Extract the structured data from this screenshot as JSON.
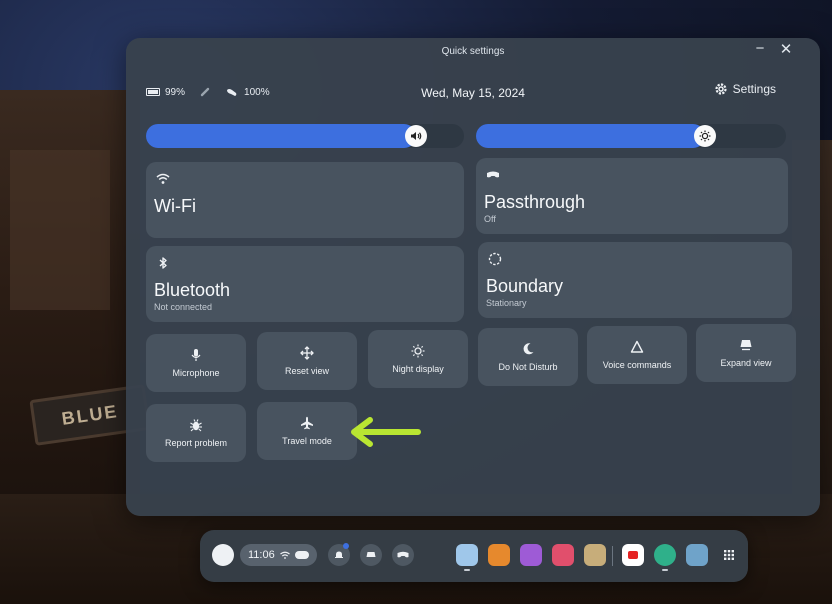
{
  "panel": {
    "title": "Quick settings",
    "minimize_glyph": "−",
    "close_glyph": "✕"
  },
  "status": {
    "battery": "99%",
    "controller_battery": "100%",
    "date": "Wed, May 15, 2024",
    "settings_label": "Settings"
  },
  "sliders": {
    "volume": 0.85,
    "brightness": 0.74
  },
  "tiles": {
    "wifi": {
      "label": "Wi-Fi",
      "icon": "wifi-icon"
    },
    "passthrough": {
      "label": "Passthrough",
      "sub": "Off",
      "icon": "headset-icon"
    },
    "bluetooth": {
      "label": "Bluetooth",
      "sub": "Not connected",
      "icon": "bluetooth-icon"
    },
    "boundary": {
      "label": "Boundary",
      "sub": "Stationary",
      "icon": "boundary-icon"
    }
  },
  "small_tiles": [
    {
      "label": "Microphone",
      "icon": "microphone-icon"
    },
    {
      "label": "Reset view",
      "icon": "move-icon"
    },
    {
      "label": "Night display",
      "icon": "sun-icon"
    },
    {
      "label": "Do Not Disturb",
      "icon": "moon-icon"
    },
    {
      "label": "Voice commands",
      "icon": "voice-icon"
    },
    {
      "label": "Expand view",
      "icon": "expand-icon"
    },
    {
      "label": "Report problem",
      "icon": "bug-icon"
    },
    {
      "label": "Travel mode",
      "icon": "airplane-icon"
    }
  ],
  "annotation": {
    "color": "#b9e632"
  },
  "taskbar": {
    "time": "11:06"
  },
  "colors": {
    "accent": "#3d6fdf",
    "panel": "#38424d"
  }
}
